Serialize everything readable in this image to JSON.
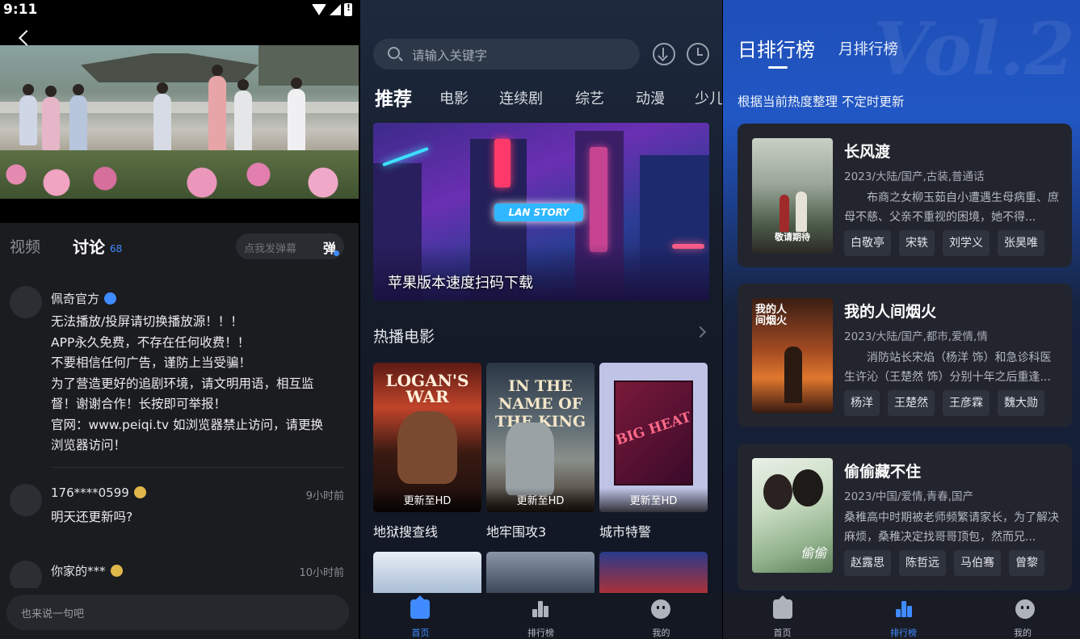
{
  "screen1": {
    "status_time": "9:11",
    "tabs": {
      "video": "视频",
      "discussion": "讨论",
      "discussion_count": "68"
    },
    "danmu": {
      "placeholder": "点我发弹幕",
      "button": "弹"
    },
    "comments": [
      {
        "user": "佩奇官方",
        "badge": "verified",
        "time": "",
        "lines": [
          "无法播放/投屏请切换播放源！！！",
          "APP永久免费，不存在任何收费！！",
          "不要相信任何广告，谨防上当受骗！",
          "为了营造更好的追剧环境，请文明用语，相互监",
          "督！谢谢合作！长按即可举报！",
          "官网：www.peiqi.tv 如浏览器禁止访问，请更换",
          "浏览器访问！"
        ]
      },
      {
        "user": "176****0599",
        "badge": "vip",
        "time": "9小时前",
        "lines": [
          "明天还更新吗?"
        ]
      },
      {
        "user": "你家的***",
        "badge": "vip",
        "time": "10小时前",
        "lines": []
      }
    ],
    "input_placeholder": "也来说一句吧"
  },
  "screen2": {
    "search_placeholder": "请输入关键字",
    "categories": [
      "推荐",
      "电影",
      "连续剧",
      "综艺",
      "动漫",
      "少儿"
    ],
    "banner": {
      "caption": "苹果版本速度扫码下载",
      "neon_sign": "LAN STORY"
    },
    "section_title": "热播电影",
    "movies": [
      {
        "name": "地狱搜查线",
        "tag": "更新至HD",
        "poster_text": "LOGAN'S WAR"
      },
      {
        "name": "地牢围攻3",
        "tag": "更新至HD",
        "poster_text": "IN THE NAME OF THE KING"
      },
      {
        "name": "城市特警",
        "tag": "更新至HD",
        "poster_text": "BIG HEAT"
      }
    ],
    "nav": [
      "首页",
      "排行榜",
      "我的"
    ]
  },
  "screen3": {
    "tabs": {
      "day": "日排行榜",
      "month": "月排行榜"
    },
    "subtitle": "根据当前热度整理 不定时更新",
    "ranks": [
      {
        "title": "长风渡",
        "meta": "2023/大陆/国产,古装,普通话",
        "desc": "布商之女柳玉茹自小遭遇生母病重、庶母不慈、父亲不重视的困境，她不得...",
        "cast": [
          "白敬亭",
          "宋轶",
          "刘学义",
          "张昊唯"
        ],
        "cover_text": "敬请期待"
      },
      {
        "title": "我的人间烟火",
        "meta": "2023/大陆/国产,都市,爱情,情",
        "desc": "消防站长宋焰（杨洋 饰）和急诊科医生许沁（王楚然 饰）分别十年之后重逢...",
        "cast": [
          "杨洋",
          "王楚然",
          "王彦霖",
          "魏大勋"
        ],
        "cover_text": "我的人间烟火"
      },
      {
        "title": "偷偷藏不住",
        "meta": "2023/中国/爱情,青春,国产",
        "desc": "桑稚高中时期被老师频繁请家长，为了解决麻烦，桑稚决定找哥哥顶包，然而兄...",
        "cast": [
          "赵露思",
          "陈哲远",
          "马伯骞",
          "曾黎"
        ],
        "cover_text": "偷偷"
      }
    ],
    "nav": [
      "首页",
      "排行榜",
      "我的"
    ]
  },
  "colors": {
    "accent_blue": "#3f8bff",
    "vip_gold": "#e0b74a"
  }
}
